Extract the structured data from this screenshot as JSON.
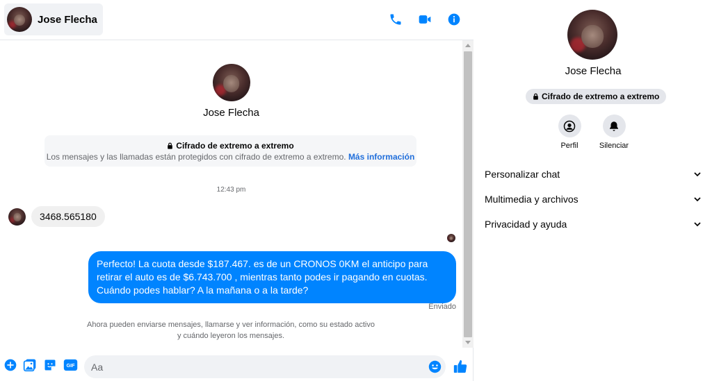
{
  "contact": {
    "name": "Jose Flecha"
  },
  "header": {
    "call_icon": "phone-icon",
    "video_icon": "video-camera-icon",
    "info_icon": "info-icon"
  },
  "conversation": {
    "encryption": {
      "title": "Cifrado de extremo a extremo",
      "description": "Los mensajes y las llamadas están protegidos con cifrado de extremo a extremo.",
      "link": "Más información"
    },
    "timestamp": "12:43 pm",
    "incoming_message": "3468.565180",
    "outgoing_message": "Perfecto! La cuota desde $187.467. es de un CRONOS 0KM el anticipo para retirar el auto es de $6.743.700 , mientras tanto podes ir pagando en cuotas. Cuándo podes hablar? A la mañana o a la tarde?",
    "status": "Enviado",
    "system_note_line1": "Ahora pueden enviarse mensajes, llamarse y ver información, como su estado activo",
    "system_note_line2": "y cuándo leyeron los mensajes."
  },
  "composer": {
    "placeholder": "Aa",
    "tools": [
      "plus-circle-icon",
      "image-icon",
      "sticker-icon",
      "gif-icon"
    ],
    "gif_label": "GIF"
  },
  "info_panel": {
    "encryption_pill": "Cifrado de extremo a extremo",
    "actions": [
      {
        "label": "Perfil",
        "icon": "profile-icon"
      },
      {
        "label": "Silenciar",
        "icon": "bell-icon"
      }
    ],
    "sections": [
      {
        "label": "Personalizar chat"
      },
      {
        "label": "Multimedia y archivos"
      },
      {
        "label": "Privacidad y ayuda"
      }
    ]
  },
  "colors": {
    "accent": "#0084ff",
    "link": "#216fdb",
    "bubble_in": "#f0f0f0"
  }
}
